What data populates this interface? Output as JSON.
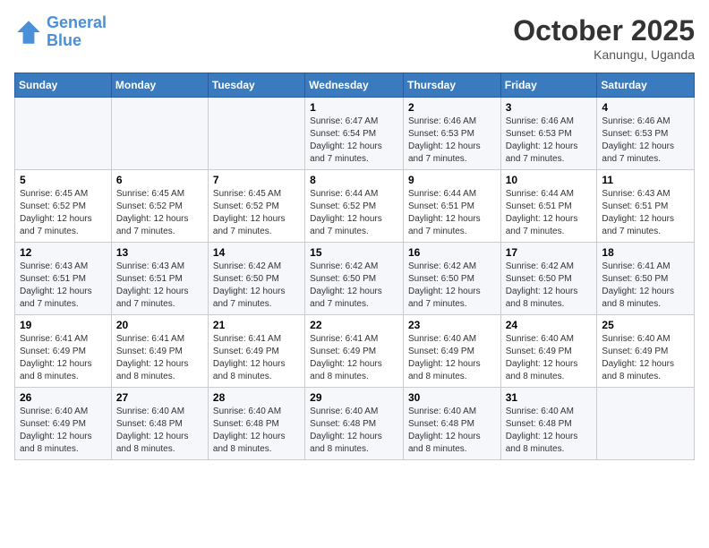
{
  "logo": {
    "line1": "General",
    "line2": "Blue"
  },
  "title": "October 2025",
  "location": "Kanungu, Uganda",
  "weekdays": [
    "Sunday",
    "Monday",
    "Tuesday",
    "Wednesday",
    "Thursday",
    "Friday",
    "Saturday"
  ],
  "weeks": [
    [
      {
        "day": "",
        "info": ""
      },
      {
        "day": "",
        "info": ""
      },
      {
        "day": "",
        "info": ""
      },
      {
        "day": "1",
        "info": "Sunrise: 6:47 AM\nSunset: 6:54 PM\nDaylight: 12 hours and 7 minutes."
      },
      {
        "day": "2",
        "info": "Sunrise: 6:46 AM\nSunset: 6:53 PM\nDaylight: 12 hours and 7 minutes."
      },
      {
        "day": "3",
        "info": "Sunrise: 6:46 AM\nSunset: 6:53 PM\nDaylight: 12 hours and 7 minutes."
      },
      {
        "day": "4",
        "info": "Sunrise: 6:46 AM\nSunset: 6:53 PM\nDaylight: 12 hours and 7 minutes."
      }
    ],
    [
      {
        "day": "5",
        "info": "Sunrise: 6:45 AM\nSunset: 6:52 PM\nDaylight: 12 hours and 7 minutes."
      },
      {
        "day": "6",
        "info": "Sunrise: 6:45 AM\nSunset: 6:52 PM\nDaylight: 12 hours and 7 minutes."
      },
      {
        "day": "7",
        "info": "Sunrise: 6:45 AM\nSunset: 6:52 PM\nDaylight: 12 hours and 7 minutes."
      },
      {
        "day": "8",
        "info": "Sunrise: 6:44 AM\nSunset: 6:52 PM\nDaylight: 12 hours and 7 minutes."
      },
      {
        "day": "9",
        "info": "Sunrise: 6:44 AM\nSunset: 6:51 PM\nDaylight: 12 hours and 7 minutes."
      },
      {
        "day": "10",
        "info": "Sunrise: 6:44 AM\nSunset: 6:51 PM\nDaylight: 12 hours and 7 minutes."
      },
      {
        "day": "11",
        "info": "Sunrise: 6:43 AM\nSunset: 6:51 PM\nDaylight: 12 hours and 7 minutes."
      }
    ],
    [
      {
        "day": "12",
        "info": "Sunrise: 6:43 AM\nSunset: 6:51 PM\nDaylight: 12 hours and 7 minutes."
      },
      {
        "day": "13",
        "info": "Sunrise: 6:43 AM\nSunset: 6:51 PM\nDaylight: 12 hours and 7 minutes."
      },
      {
        "day": "14",
        "info": "Sunrise: 6:42 AM\nSunset: 6:50 PM\nDaylight: 12 hours and 7 minutes."
      },
      {
        "day": "15",
        "info": "Sunrise: 6:42 AM\nSunset: 6:50 PM\nDaylight: 12 hours and 7 minutes."
      },
      {
        "day": "16",
        "info": "Sunrise: 6:42 AM\nSunset: 6:50 PM\nDaylight: 12 hours and 7 minutes."
      },
      {
        "day": "17",
        "info": "Sunrise: 6:42 AM\nSunset: 6:50 PM\nDaylight: 12 hours and 8 minutes."
      },
      {
        "day": "18",
        "info": "Sunrise: 6:41 AM\nSunset: 6:50 PM\nDaylight: 12 hours and 8 minutes."
      }
    ],
    [
      {
        "day": "19",
        "info": "Sunrise: 6:41 AM\nSunset: 6:49 PM\nDaylight: 12 hours and 8 minutes."
      },
      {
        "day": "20",
        "info": "Sunrise: 6:41 AM\nSunset: 6:49 PM\nDaylight: 12 hours and 8 minutes."
      },
      {
        "day": "21",
        "info": "Sunrise: 6:41 AM\nSunset: 6:49 PM\nDaylight: 12 hours and 8 minutes."
      },
      {
        "day": "22",
        "info": "Sunrise: 6:41 AM\nSunset: 6:49 PM\nDaylight: 12 hours and 8 minutes."
      },
      {
        "day": "23",
        "info": "Sunrise: 6:40 AM\nSunset: 6:49 PM\nDaylight: 12 hours and 8 minutes."
      },
      {
        "day": "24",
        "info": "Sunrise: 6:40 AM\nSunset: 6:49 PM\nDaylight: 12 hours and 8 minutes."
      },
      {
        "day": "25",
        "info": "Sunrise: 6:40 AM\nSunset: 6:49 PM\nDaylight: 12 hours and 8 minutes."
      }
    ],
    [
      {
        "day": "26",
        "info": "Sunrise: 6:40 AM\nSunset: 6:49 PM\nDaylight: 12 hours and 8 minutes."
      },
      {
        "day": "27",
        "info": "Sunrise: 6:40 AM\nSunset: 6:48 PM\nDaylight: 12 hours and 8 minutes."
      },
      {
        "day": "28",
        "info": "Sunrise: 6:40 AM\nSunset: 6:48 PM\nDaylight: 12 hours and 8 minutes."
      },
      {
        "day": "29",
        "info": "Sunrise: 6:40 AM\nSunset: 6:48 PM\nDaylight: 12 hours and 8 minutes."
      },
      {
        "day": "30",
        "info": "Sunrise: 6:40 AM\nSunset: 6:48 PM\nDaylight: 12 hours and 8 minutes."
      },
      {
        "day": "31",
        "info": "Sunrise: 6:40 AM\nSunset: 6:48 PM\nDaylight: 12 hours and 8 minutes."
      },
      {
        "day": "",
        "info": ""
      }
    ]
  ]
}
